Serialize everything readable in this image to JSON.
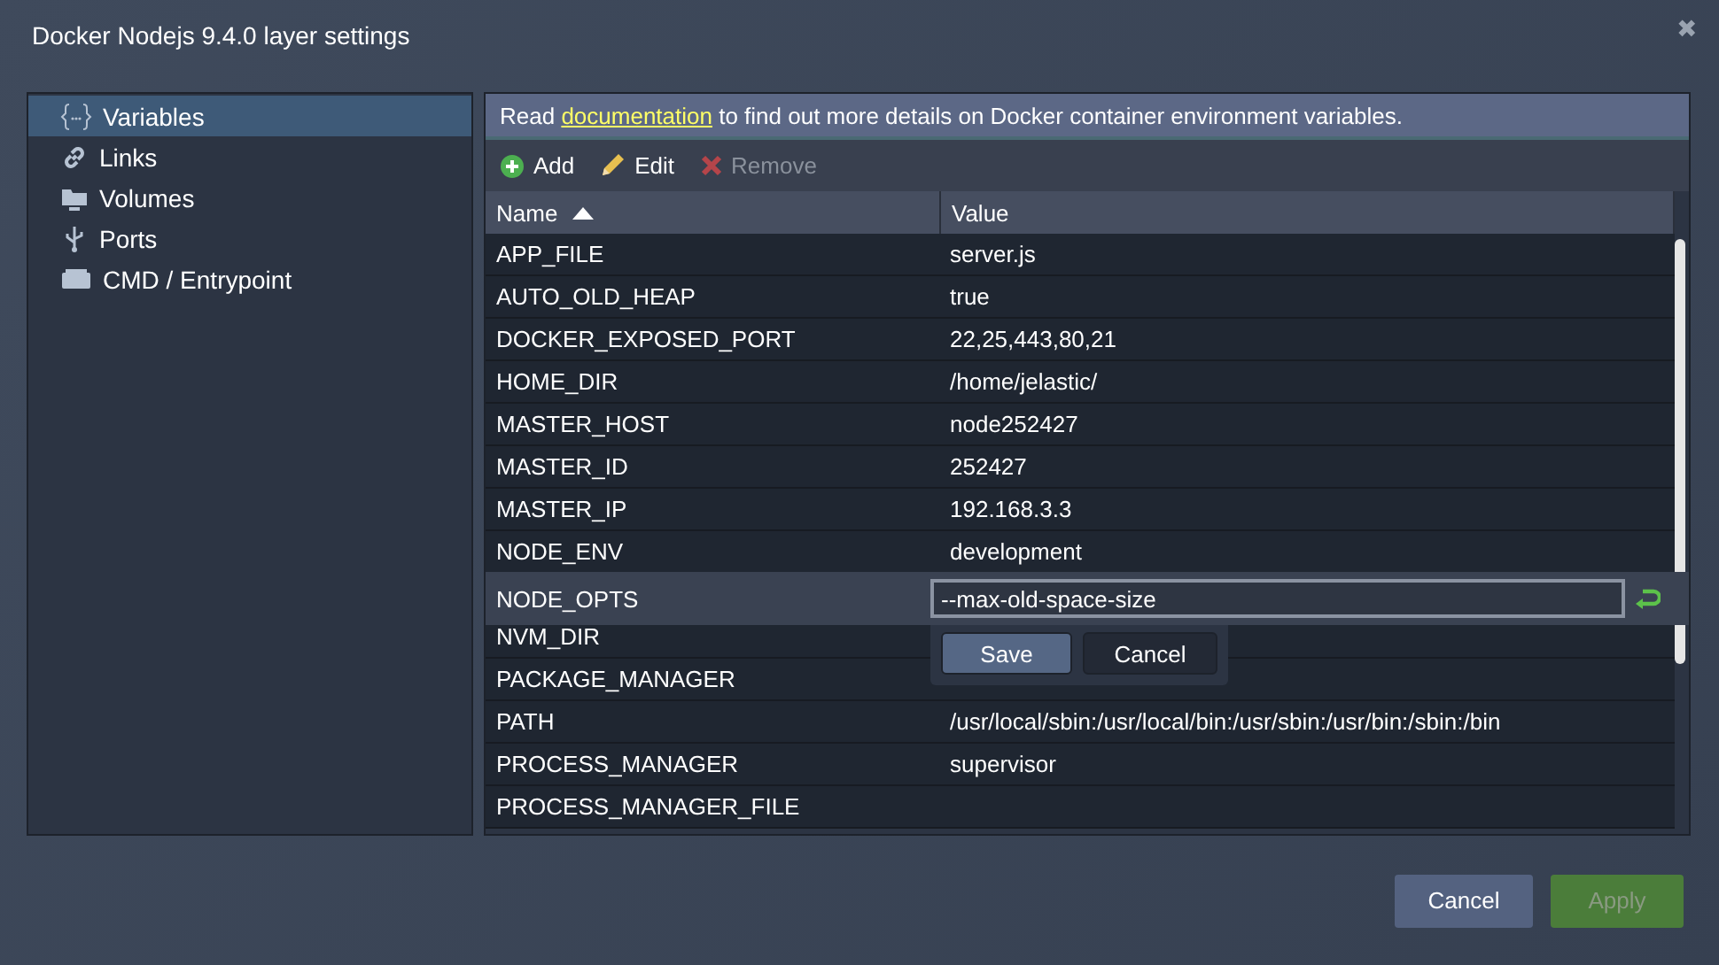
{
  "window": {
    "title": "Docker Nodejs 9.4.0 layer settings",
    "close": "✖"
  },
  "sidebar": {
    "items": [
      {
        "label": "Variables",
        "kind": "braces",
        "selected": true
      },
      {
        "label": "Links",
        "kind": "link",
        "selected": false
      },
      {
        "label": "Volumes",
        "kind": "folder",
        "selected": false
      },
      {
        "label": "Ports",
        "kind": "usb",
        "selected": false
      },
      {
        "label": "CMD / Entrypoint",
        "kind": "cmd",
        "selected": false
      }
    ]
  },
  "info": {
    "before": "Read ",
    "link": "documentation",
    "after": " to find out more details on Docker container environment variables."
  },
  "toolbar": [
    {
      "label": "Add",
      "kind": "add",
      "disabled": false
    },
    {
      "label": "Edit",
      "kind": "edit",
      "disabled": false
    },
    {
      "label": "Remove",
      "kind": "remove",
      "disabled": true
    }
  ],
  "table": {
    "columns": [
      {
        "label": "Name",
        "sorted_ascending": true
      },
      {
        "label": "Value"
      }
    ],
    "rows": [
      {
        "name": "APP_FILE",
        "value": "server.js",
        "editing": false
      },
      {
        "name": "AUTO_OLD_HEAP",
        "value": "true",
        "editing": false
      },
      {
        "name": "DOCKER_EXPOSED_PORT",
        "value": "22,25,443,80,21",
        "editing": false
      },
      {
        "name": "HOME_DIR",
        "value": "/home/jelastic/",
        "editing": false
      },
      {
        "name": "MASTER_HOST",
        "value": "node252427",
        "editing": false
      },
      {
        "name": "MASTER_ID",
        "value": "252427",
        "editing": false
      },
      {
        "name": "MASTER_IP",
        "value": "192.168.3.3",
        "editing": false
      },
      {
        "name": "NODE_ENV",
        "value": "development",
        "editing": false
      },
      {
        "name": "NODE_OPTS",
        "value": "--max-old-space-size",
        "editing": true
      },
      {
        "name": "NVM_DIR",
        "value": "",
        "editing": false
      },
      {
        "name": "PACKAGE_MANAGER",
        "value": "",
        "editing": false
      },
      {
        "name": "PATH",
        "value": "/usr/local/sbin:/usr/local/bin:/usr/sbin:/usr/bin:/sbin:/bin",
        "editing": false
      },
      {
        "name": "PROCESS_MANAGER",
        "value": "supervisor",
        "editing": false
      },
      {
        "name": "PROCESS_MANAGER_FILE",
        "value": "",
        "editing": false
      }
    ]
  },
  "editor": {
    "buttons": [
      {
        "label": "Save",
        "primary": true
      },
      {
        "label": "Cancel",
        "primary": false
      }
    ]
  },
  "footer": [
    {
      "label": "Cancel",
      "kind": "cancel",
      "disabled": false
    },
    {
      "label": "Apply",
      "kind": "apply",
      "disabled": true
    }
  ]
}
